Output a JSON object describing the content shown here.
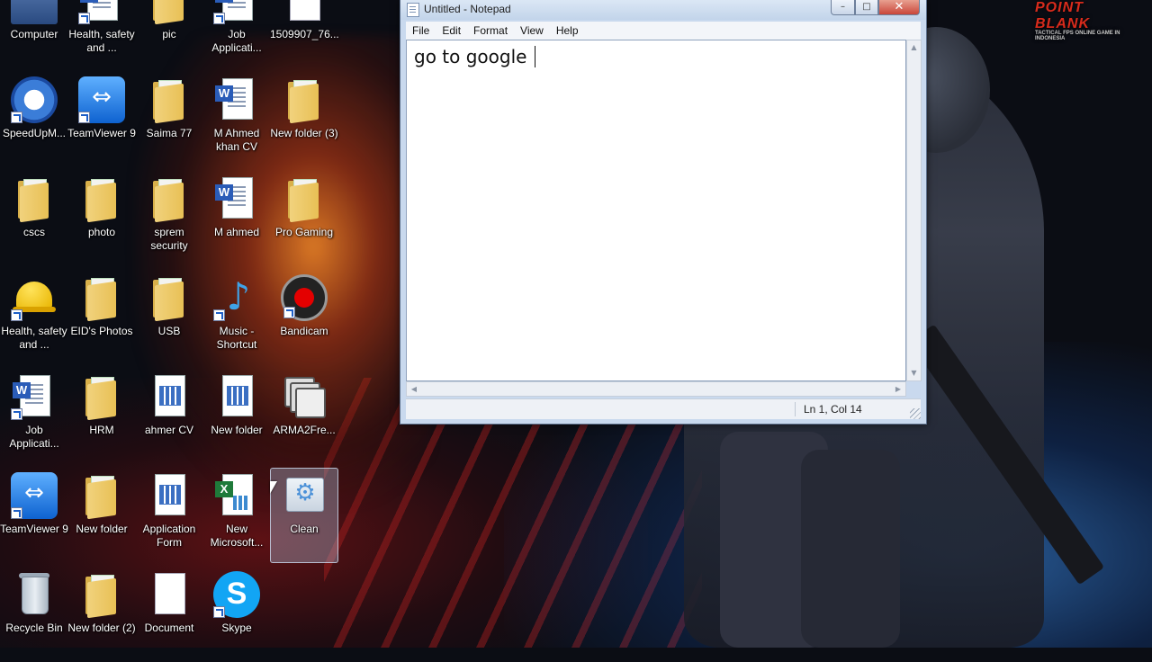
{
  "wallpaper": {
    "logo": "POINT BLANK",
    "logo_tagline": "TACTICAL FPS ONLINE GAME IN INDONESIA"
  },
  "desktop": {
    "icons": [
      {
        "label": "Computer",
        "glyph": "computer-icon"
      },
      {
        "label": "Health, safety and ...",
        "glyph": "word-document-icon"
      },
      {
        "label": "pic",
        "glyph": "folder-icon"
      },
      {
        "label": "Job Applicati...",
        "glyph": "word-document-icon"
      },
      {
        "label": "1509907_76...",
        "glyph": "image-icon"
      },
      {
        "label": "SpeedUpM...",
        "glyph": "speedometer-icon"
      },
      {
        "label": "TeamViewer 9",
        "glyph": "teamviewer-icon"
      },
      {
        "label": "Saima 77",
        "glyph": "folder-icon"
      },
      {
        "label": "M Ahmed khan CV",
        "glyph": "word-document-icon"
      },
      {
        "label": "New folder (3)",
        "glyph": "folder-icon"
      },
      {
        "label": "cscs",
        "glyph": "folder-icon"
      },
      {
        "label": "photo",
        "glyph": "folder-icon"
      },
      {
        "label": "sprem security",
        "glyph": "folder-icon"
      },
      {
        "label": "M ahmed",
        "glyph": "word-document-icon"
      },
      {
        "label": "Pro Gaming",
        "glyph": "folder-icon"
      },
      {
        "label": "Health, safety and ...",
        "glyph": "hard-hat-icon"
      },
      {
        "label": "EID's Photos",
        "glyph": "folder-icon"
      },
      {
        "label": "USB",
        "glyph": "folder-icon"
      },
      {
        "label": "Music - Shortcut",
        "glyph": "music-note-icon"
      },
      {
        "label": "Bandicam",
        "glyph": "bandicam-record-icon"
      },
      {
        "label": "Job Applicati...",
        "glyph": "word-document-icon"
      },
      {
        "label": "HRM",
        "glyph": "folder-icon"
      },
      {
        "label": "ahmer CV",
        "glyph": "calendar-document-icon"
      },
      {
        "label": "New folder",
        "glyph": "calendar-document-icon"
      },
      {
        "label": "ARMA2Fre...",
        "glyph": "stacked-windows-icon"
      },
      {
        "label": "TeamViewer 9",
        "glyph": "teamviewer-icon"
      },
      {
        "label": "New folder",
        "glyph": "folder-icon"
      },
      {
        "label": "Application Form",
        "glyph": "calendar-document-icon"
      },
      {
        "label": "New Microsoft...",
        "glyph": "excel-document-icon"
      },
      {
        "label": "Clean",
        "glyph": "cleanup-gear-icon"
      },
      {
        "label": "Recycle Bin",
        "glyph": "recycle-bin-icon"
      },
      {
        "label": "New folder (2)",
        "glyph": "folder-icon"
      },
      {
        "label": "Document",
        "glyph": "blank-document-icon"
      },
      {
        "label": "Skype",
        "glyph": "skype-icon"
      }
    ]
  },
  "notepad": {
    "title": "Untitled - Notepad",
    "menu": [
      "File",
      "Edit",
      "Format",
      "View",
      "Help"
    ],
    "content": "go to google ",
    "status": "Ln 1, Col 14",
    "controls": {
      "minimize": "–",
      "maximize": "□",
      "close": "✕"
    }
  },
  "colors": {
    "titlebar": "#c2d4ea",
    "close_button": "#c9463a",
    "selection": "#b4c8e6"
  }
}
